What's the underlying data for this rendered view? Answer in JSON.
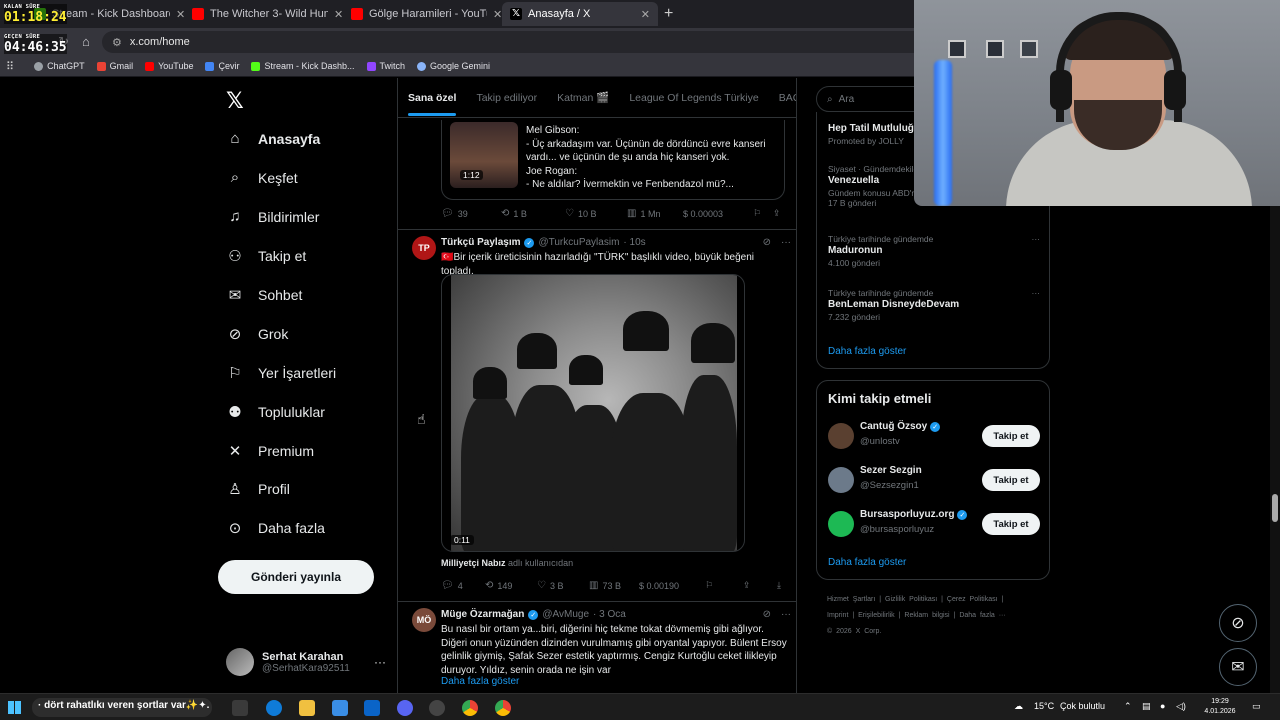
{
  "browser": {
    "tabs": [
      {
        "label": "Stream - Kick Dashboard",
        "color": "#53fc18"
      },
      {
        "label": "The Witcher 3- Wild Hunt OST",
        "color": "#ff0000"
      },
      {
        "label": "Gölge Haramileri - YouTube",
        "color": "#ff0000"
      },
      {
        "label": "Anasayfa / X",
        "color": "#ffffff"
      }
    ],
    "url": "x.com/home",
    "bookmarks": [
      {
        "label": "ChatGPT",
        "color": "#9aa0a6"
      },
      {
        "label": "Gmail",
        "color": "#ea4335"
      },
      {
        "label": "YouTube",
        "color": "#ff0000"
      },
      {
        "label": "Çevir",
        "color": "#4285f4"
      },
      {
        "label": "Stream - Kick Dashb...",
        "color": "#53fc18"
      },
      {
        "label": "Twitch",
        "color": "#9146ff"
      },
      {
        "label": "Google Gemini",
        "color": "#8ab4f8"
      }
    ]
  },
  "timers": {
    "remaining_label": "KALAN SÜRE",
    "remaining_value": "01:18:24",
    "elapsed_label": "GEÇEN SÜRE",
    "elapsed_value": "04:46:35"
  },
  "nav": {
    "items": [
      {
        "label": "Anasayfa",
        "icon": "home-icon"
      },
      {
        "label": "Keşfet",
        "icon": "search-icon"
      },
      {
        "label": "Bildirimler",
        "icon": "bell-icon"
      },
      {
        "label": "Takip et",
        "icon": "add-user-icon"
      },
      {
        "label": "Sohbet",
        "icon": "mail-icon"
      },
      {
        "label": "Grok",
        "icon": "grok-icon"
      },
      {
        "label": "Yer İşaretleri",
        "icon": "bookmark-icon"
      },
      {
        "label": "Topluluklar",
        "icon": "people-icon"
      },
      {
        "label": "Premium",
        "icon": "x-icon"
      },
      {
        "label": "Profil",
        "icon": "person-icon"
      },
      {
        "label": "Daha fazla",
        "icon": "more-circle-icon"
      }
    ],
    "post_button": "Gönderi yayınla",
    "account": {
      "name": "Serhat Karahan",
      "handle": "@SerhatKara92511"
    }
  },
  "timeline": {
    "tabs": [
      "Sana özel",
      "Takip ediliyor",
      "Katman 🎬",
      "League Of Legends Türkiye",
      "BACIL"
    ],
    "quote": {
      "video_duration": "1:12",
      "lines": [
        "Mel Gibson:",
        "- Üç arkadaşım var. Üçünün de dördüncü evre kanseri vardı... ve üçünün de şu anda hiç kanseri yok.",
        "Joe Rogan:",
        "- Ne aldılar? İvermektin ve Fenbendazol mü?..."
      ]
    },
    "post1_actions": {
      "replies": "39",
      "reposts": "1 B",
      "likes": "10 B",
      "views": "1 Mn",
      "earnings": "$ 0.00003"
    },
    "post2": {
      "name": "Türkçü Paylaşım",
      "handle": "@TurkcuPaylasim",
      "time": "· 10s",
      "text": "🇹🇷Bir içerik üreticisinin hazırladığı \"TÜRK\" başlıklı video, büyük beğeni topladı.",
      "video_duration": "0:11",
      "source_name": "Milliyetçi Nabız",
      "source_suffix": "adlı kullanıcıdan",
      "actions": {
        "replies": "4",
        "reposts": "149",
        "likes": "3 B",
        "views": "73 B",
        "earnings": "$ 0.00190"
      }
    },
    "post3": {
      "name": "Müge Özarmağan",
      "handle": "@AvMuge",
      "time": "· 3 Oca",
      "text": "Bu nasıl bir ortam ya...biri, diğerini hiç tekme tokat dövmemiş gibi ağlıyor. Diğeri onun yüzünden dizinden vurulmamış gibi oryantal yapıyor. Bülent Ersoy gelinlik giymiş, Şafak Sezer estetik yaptırmış. Cengiz Kurtoğlu ceket ilikleyip duruyor. Yıldız, senin orada ne işin var",
      "show_more": "Daha fazla göster"
    }
  },
  "right": {
    "search_placeholder": "Ara",
    "promo": {
      "title": "Hep Tatil Mutluluğ",
      "sub": "Promoted by JOLLY"
    },
    "trends": [
      {
        "context": "Siyaset · Gündemdekile",
        "title": "Venezuella",
        "meta1": "Gündem konusu ABD'n",
        "meta2": "17 B gönderi"
      },
      {
        "context": "Türkiye tarihinde gündemde",
        "title": "Maduronun",
        "meta1": "4.100 gönderi"
      },
      {
        "context": "Türkiye tarihinde gündemde",
        "title": "BenLeman DisneydeDevam",
        "meta1": "7.232 gönderi"
      }
    ],
    "trends_more": "Daha fazla göster",
    "follow_title": "Kimi takip etmeli",
    "follow": [
      {
        "name": "Cantuğ Özsoy",
        "handle": "@unlostv",
        "button": "Takip et",
        "color": "#5a4030"
      },
      {
        "name": "Sezer Sezgin",
        "handle": "@Sezsezgin1",
        "button": "Takip et",
        "color": "#6c7a8a"
      },
      {
        "name": "Bursasporluyuz.org",
        "handle": "@bursasporluyuz",
        "button": "Takip et",
        "color": "#1db954"
      }
    ],
    "follow_more": "Daha fazla göster",
    "footer": [
      "Hizmet Şartları",
      "Gizlilik Politikası",
      "Çerez Politikası",
      "Imprint",
      "Erişilebilirlik",
      "Reklam bilgisi",
      "Daha fazla ···",
      "© 2026 X Corp."
    ]
  },
  "taskbar": {
    "ticker": "· dört rahatlıkı veren şortlar var✨✦.",
    "weather": "15°C",
    "weather_desc": "Çok bulutlu",
    "time": "19:29",
    "date": "4.01.2026"
  }
}
